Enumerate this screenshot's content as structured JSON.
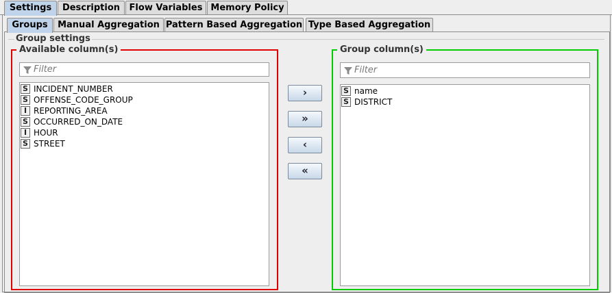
{
  "top_tabs": [
    "Settings",
    "Description",
    "Flow Variables",
    "Memory Policy"
  ],
  "sub_tabs": [
    "Groups",
    "Manual Aggregation",
    "Pattern Based Aggregation",
    "Type Based Aggregation"
  ],
  "group_settings_title": "Group settings",
  "available": {
    "title": "Available column(s)",
    "filter_placeholder": "Filter",
    "items": [
      {
        "type": "S",
        "name": "INCIDENT_NUMBER"
      },
      {
        "type": "S",
        "name": "OFFENSE_CODE_GROUP"
      },
      {
        "type": "I",
        "name": "REPORTING_AREA"
      },
      {
        "type": "S",
        "name": "OCCURRED_ON_DATE"
      },
      {
        "type": "I",
        "name": "HOUR"
      },
      {
        "type": "S",
        "name": "STREET"
      }
    ]
  },
  "group": {
    "title": "Group column(s)",
    "filter_placeholder": "Filter",
    "items": [
      {
        "type": "S",
        "name": "name"
      },
      {
        "type": "S",
        "name": "DISTRICT"
      }
    ]
  },
  "buttons": {
    "add": "›",
    "add_all": "»",
    "remove": "‹",
    "remove_all": "«"
  },
  "colors": {
    "available_border": "#e00000",
    "group_border": "#00cc00",
    "active_tab": "#bfd4ea"
  }
}
